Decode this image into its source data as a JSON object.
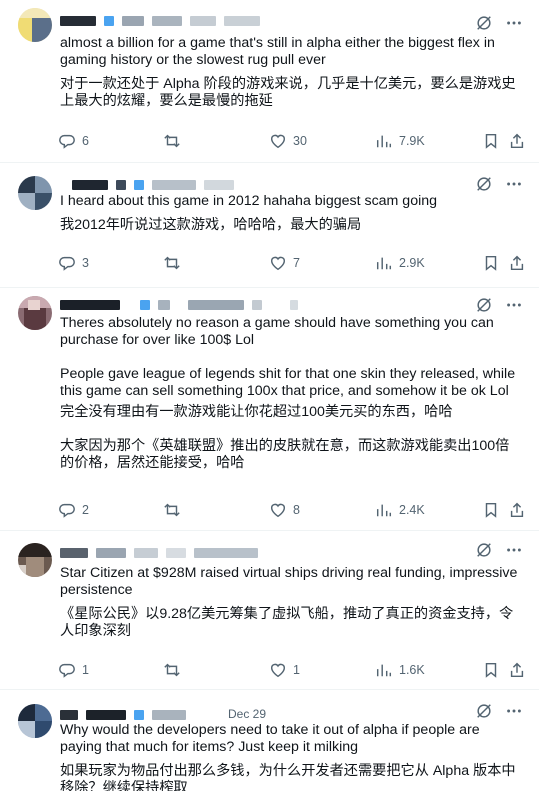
{
  "posts": [
    {
      "header_meta": "",
      "text_en": [
        "almost a billion for a game that's still in alpha either the biggest flex in gaming history or the slowest rug pull ever"
      ],
      "text_zh": [
        "对于一款还处于 Alpha 阶段的游戏来说，几乎是十亿美元，要么是游戏史上最大的炫耀，要么是最慢的拖延"
      ],
      "replies": "6",
      "reposts": "",
      "likes": "30",
      "views": "7.9K"
    },
    {
      "header_meta": "",
      "text_en": [
        "I heard about this game in 2012 hahaha biggest scam going"
      ],
      "text_zh": [
        "我2012年听说过这款游戏，哈哈哈，最大的骗局"
      ],
      "replies": "3",
      "reposts": "",
      "likes": "7",
      "views": "2.9K"
    },
    {
      "header_meta": "",
      "text_en": [
        "Theres absolutely no reason a game should have something you can purchase for over like 100$ Lol",
        "People gave league of legends shit for that one skin they released, while this game can sell something 100x that price, and somehow it be ok Lol"
      ],
      "text_zh": [
        "完全没有理由有一款游戏能让你花超过100美元买的东西，哈哈",
        "大家因为那个《英雄联盟》推出的皮肤就在意，而这款游戏能卖出100倍的价格，居然还能接受，哈哈"
      ],
      "replies": "2",
      "reposts": "",
      "likes": "8",
      "views": "2.4K"
    },
    {
      "header_meta": "",
      "text_en": [
        "Star Citizen at $928M raised virtual ships driving real funding, impressive persistence"
      ],
      "text_zh": [
        "《星际公民》以9.28亿美元筹集了虚拟飞船，推动了真正的资金支持，令人印象深刻"
      ],
      "replies": "1",
      "reposts": "",
      "likes": "1",
      "views": "1.6K"
    },
    {
      "header_meta": "Dec 29",
      "text_en": [
        "Why would the developers need to take it out of alpha if people are paying that much for items? Just keep it milking"
      ],
      "text_zh": [
        "如果玩家为物品付出那么多钱，为什么开发者还需要把它从 Alpha 版本中移除？继续保持榨取"
      ],
      "replies": "",
      "reposts": "",
      "likes": "",
      "views": ""
    }
  ],
  "icons": {
    "reply": "reply-icon",
    "repost": "repost-icon",
    "like": "heart-icon",
    "views": "views-icon",
    "bookmark": "bookmark-icon",
    "share": "share-icon",
    "grok": "grok-icon",
    "more": "more-icon"
  }
}
